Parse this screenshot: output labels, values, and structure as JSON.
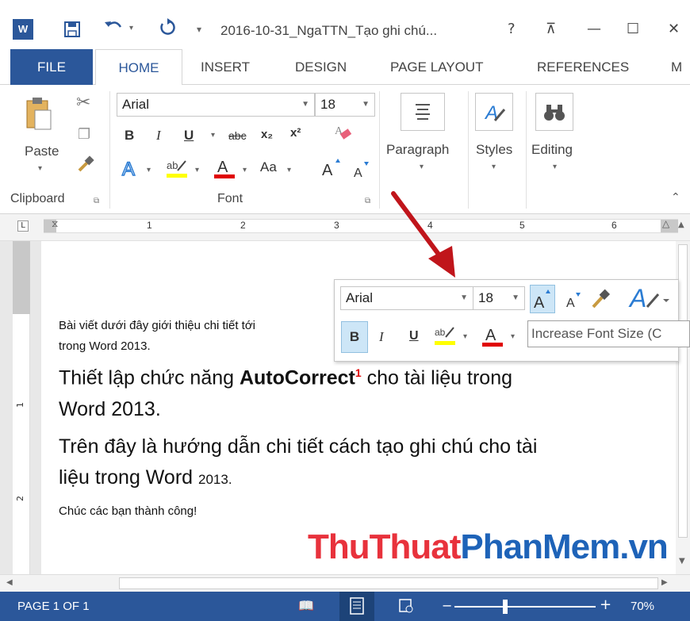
{
  "title_bar": {
    "title": "2016-10-31_NgaTTN_Tạo ghi chú...",
    "help": "?",
    "ribbon_display": "⊼",
    "minimize": "—",
    "maximize": "☐",
    "close": "✕"
  },
  "tabs": [
    "FILE",
    "HOME",
    "INSERT",
    "DESIGN",
    "PAGE LAYOUT",
    "REFERENCES",
    "M"
  ],
  "ribbon": {
    "clipboard": {
      "paste": "Paste",
      "group": "Clipboard"
    },
    "font": {
      "name": "Arial",
      "size": "18",
      "bold": "B",
      "italic": "I",
      "underline": "U",
      "strike": "abc",
      "subscript": "x₂",
      "superscript": "x²",
      "change_case": "Aa",
      "group": "Font"
    },
    "paragraph": "Paragraph",
    "styles": "Styles",
    "editing": "Editing"
  },
  "ruler": {
    "numbers": [
      "1",
      "2",
      "3",
      "4",
      "5",
      "6"
    ]
  },
  "document": {
    "line1": "Bài viết dưới đây giới thiệu chi tiết tới",
    "line2": "trong Word 2013.",
    "line3_pre": "Thiết lập chức năng ",
    "line3_bold": "AutoCorrect",
    "line3_sup": "1",
    "line3_post": " cho tài liệu trong",
    "line4": "Word 2013.",
    "line5": "Trên đây là hướng dẫn chi tiết cách tạo ghi chú cho tài",
    "line6_pre": "liệu trong Word ",
    "line6_small": "2013.",
    "line7": "Chúc các bạn thành công!"
  },
  "mini_toolbar": {
    "font": "Arial",
    "size": "18",
    "bold": "B",
    "italic": "I",
    "underline": "U"
  },
  "tooltip": "Increase Font Size (C",
  "watermark": {
    "part1": "ThuThuat",
    "part2": "PhanMem",
    "part3": ".vn"
  },
  "status": {
    "page": "PAGE 1 OF 1",
    "zoom": "70%"
  },
  "colors": {
    "accent": "#2b579a",
    "highlight": "#ffff00",
    "font_red": "#e00000",
    "arrow": "#c0151b",
    "watermark_red": "#e8323c",
    "watermark_blue": "#1e63b8"
  }
}
